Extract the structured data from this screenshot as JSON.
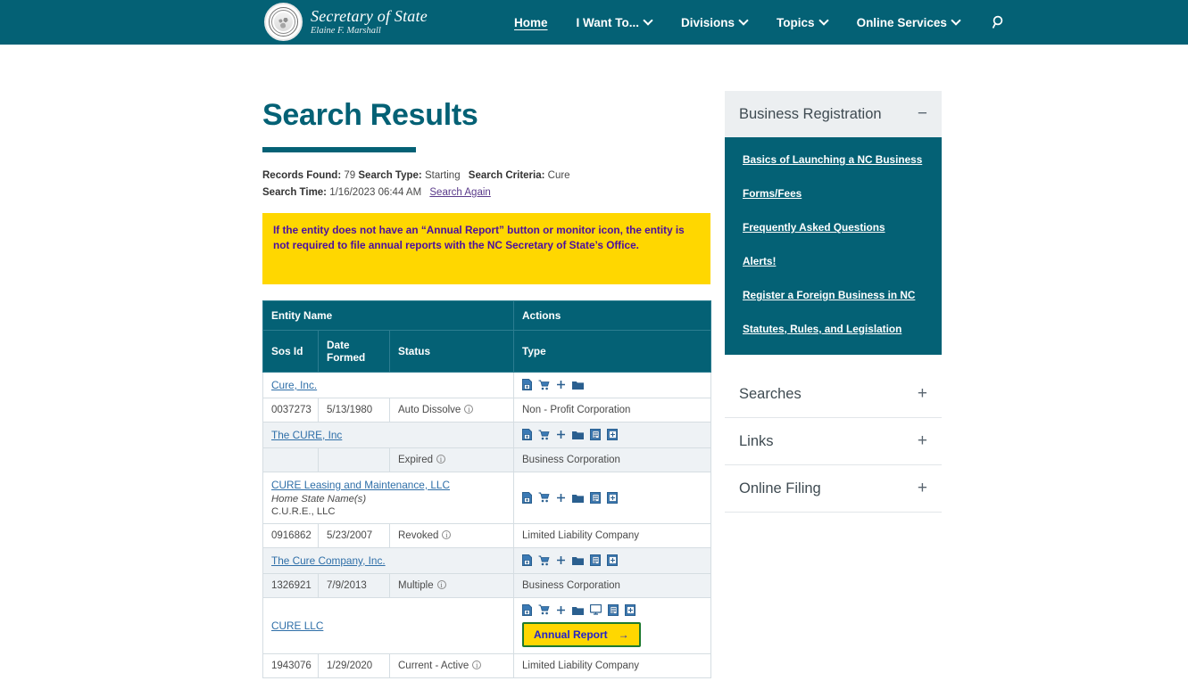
{
  "header": {
    "brand_line1": "Secretary of State",
    "brand_line2": "Elaine F. Marshall",
    "seal_name": "nc-state-seal",
    "nav": [
      {
        "label": "Home",
        "has_caret": false,
        "active": true
      },
      {
        "label": "I Want To...",
        "has_caret": true,
        "active": false
      },
      {
        "label": "Divisions",
        "has_caret": true,
        "active": false
      },
      {
        "label": "Topics",
        "has_caret": true,
        "active": false
      },
      {
        "label": "Online Services",
        "has_caret": true,
        "active": false
      }
    ],
    "search_icon": "search-icon"
  },
  "main": {
    "title": "Search Results",
    "meta": {
      "records_found_label": "Records Found:",
      "records_found_value": "79",
      "search_type_label": "Search Type:",
      "search_type_value": "Starting",
      "search_criteria_label": "Search Criteria:",
      "search_criteria_value": "Cure",
      "search_time_label": "Search Time:",
      "search_time_value": "1/16/2023 06:44 AM",
      "search_again_link": "Search Again"
    },
    "notice": "If the entity does not have an “Annual Report” button or monitor icon, the entity is not required to file annual reports with the NC Secretary of State’s Office.",
    "table": {
      "header_row1": {
        "entity_name": "Entity Name",
        "actions": "Actions"
      },
      "header_row2": {
        "sos_id": "Sos Id",
        "date_formed": "Date Formed",
        "status": "Status",
        "type": "Type"
      },
      "rows": [
        {
          "name": "Cure, Inc.",
          "home_state_label": "",
          "home_state_value": "",
          "icons": [
            "file-add-icon",
            "shopping-cart-icon",
            "plus-icon",
            "folder-icon"
          ],
          "annual_report": null,
          "sos_id": "0037273",
          "date_formed": "5/13/1980",
          "status": "Auto Dissolve",
          "type": "Non - Profit Corporation",
          "shaded": false
        },
        {
          "name": "The CURE, Inc",
          "home_state_label": "",
          "home_state_value": "",
          "icons": [
            "file-add-icon",
            "shopping-cart-icon",
            "plus-icon",
            "folder-icon",
            "document-list-icon",
            "document-add-icon"
          ],
          "annual_report": null,
          "sos_id": "",
          "date_formed": "",
          "status": "Expired",
          "type": "Business Corporation",
          "shaded": true
        },
        {
          "name": "CURE Leasing and Maintenance, LLC",
          "home_state_label": "Home State Name(s)",
          "home_state_value": "C.U.R.E., LLC",
          "icons": [
            "file-add-icon",
            "shopping-cart-icon",
            "plus-icon",
            "folder-icon",
            "document-list-icon",
            "document-add-icon"
          ],
          "annual_report": null,
          "sos_id": "0916862",
          "date_formed": "5/23/2007",
          "status": "Revoked",
          "type": "Limited Liability Company",
          "shaded": false
        },
        {
          "name": "The Cure Company, Inc.",
          "home_state_label": "",
          "home_state_value": "",
          "icons": [
            "file-add-icon",
            "shopping-cart-icon",
            "plus-icon",
            "folder-icon",
            "document-list-icon",
            "document-add-icon"
          ],
          "annual_report": null,
          "sos_id": "1326921",
          "date_formed": "7/9/2013",
          "status": "Multiple",
          "type": "Business Corporation",
          "shaded": true
        },
        {
          "name": "CURE LLC",
          "home_state_label": "",
          "home_state_value": "",
          "icons": [
            "file-add-icon",
            "shopping-cart-icon",
            "plus-icon",
            "folder-icon",
            "monitor-icon",
            "document-list-icon",
            "document-add-icon"
          ],
          "annual_report": "Annual Report",
          "sos_id": "1943076",
          "date_formed": "1/29/2020",
          "status": "Current - Active",
          "type": "Limited Liability Company",
          "shaded": false
        }
      ]
    }
  },
  "rail": {
    "expanded": {
      "title": "Business Registration",
      "sign": "−",
      "links": [
        "Basics of Launching a NC Business",
        "Forms/Fees",
        "Frequently Asked Questions",
        "Alerts!",
        "Register a Foreign Business in NC",
        "Statutes, Rules, and Legislation"
      ]
    },
    "collapsed": [
      {
        "title": "Searches",
        "sign": "+"
      },
      {
        "title": "Links",
        "sign": "+"
      },
      {
        "title": "Online Filing",
        "sign": "+"
      }
    ]
  },
  "colors": {
    "teal": "#046175",
    "yellow": "#ffd700",
    "link_blue": "#2f6fa8",
    "notice_text": "#4b0fa0",
    "button_border_green": "#1d7a2e",
    "row_shade": "#eef2f5"
  }
}
